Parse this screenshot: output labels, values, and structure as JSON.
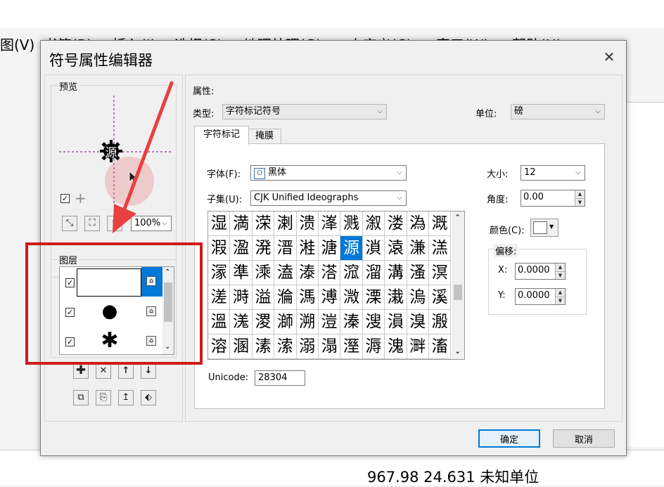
{
  "background_app": {
    "menus": [
      "图(V)",
      "书签(B)",
      "插入(I)",
      "选择(S)",
      "地理处理(G)",
      "自定义(C)",
      "窗口(W)",
      "帮助(H)"
    ],
    "status_text": "967.98  24.631 未知单位"
  },
  "dialog": {
    "title": "符号属性编辑器",
    "preview": {
      "label": "预览",
      "glyph": "源",
      "zoom": "100%"
    },
    "layers": {
      "label": "图层",
      "rows": [
        {
          "checked": true,
          "symbol": "blank",
          "locked": true,
          "selected": true
        },
        {
          "checked": true,
          "symbol": "●",
          "locked": true,
          "selected": false
        },
        {
          "checked": true,
          "symbol": "✱",
          "locked": true,
          "selected": false
        }
      ]
    },
    "properties": {
      "label": "属性:",
      "type_label": "类型:",
      "type_value": "字符标记符号",
      "unit_label": "单位:",
      "unit_value": "磅",
      "tabs": [
        "字符标记",
        "掩膜"
      ],
      "font_label": "字体(F):",
      "font_value": "黑体",
      "subset_label": "子集(U):",
      "subset_value": "CJK Unified Ideographs",
      "size_label": "大小:",
      "size_value": "12",
      "angle_label": "角度:",
      "angle_value": "0.00",
      "color_label": "颜色(C):",
      "offset_label": "偏移:",
      "x_label": "X:",
      "x_value": "0.0000",
      "y_label": "Y:",
      "y_value": "0.0000",
      "unicode_label": "Unicode:",
      "unicode_value": "28304",
      "glyphs": [
        [
          "湿",
          "満",
          "溁",
          "溂",
          "溃",
          "溄",
          "溅",
          "溆",
          "溇",
          "溈",
          "溉"
        ],
        [
          "溊",
          "溋",
          "溌",
          "溍",
          "溎",
          "溏",
          "源",
          "溑",
          "溒",
          "溓",
          "溔"
        ],
        [
          "溕",
          "準",
          "溗",
          "溘",
          "溙",
          "溚",
          "溛",
          "溜",
          "溝",
          "溞",
          "溟"
        ],
        [
          "溠",
          "溡",
          "溢",
          "溣",
          "溤",
          "溥",
          "溦",
          "溧",
          "溨",
          "溩",
          "溪"
        ],
        [
          "溫",
          "溬",
          "溭",
          "溮",
          "溯",
          "溰",
          "溱",
          "溲",
          "溳",
          "溴",
          "溵"
        ],
        [
          "溶",
          "溷",
          "溸",
          "溹",
          "溺",
          "溻",
          "溼",
          "溽",
          "溾",
          "溿",
          "滀"
        ]
      ]
    },
    "ok_label": "确定",
    "cancel_label": "取消"
  },
  "colors": {
    "selection": "#0078d7",
    "annotation_red": "#d11a1a"
  }
}
